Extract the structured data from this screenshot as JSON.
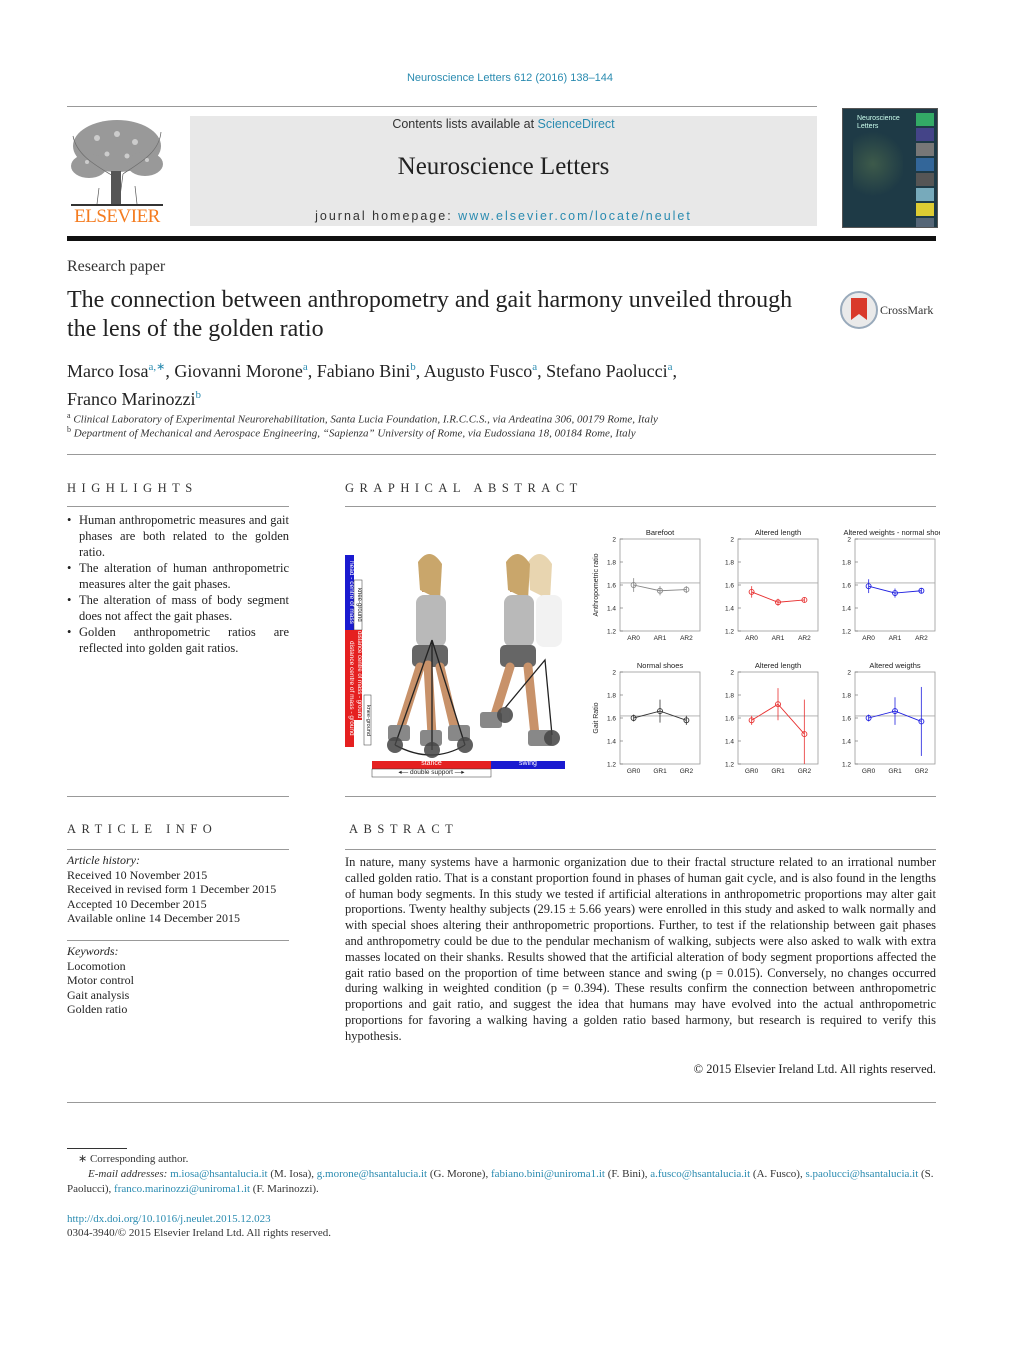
{
  "header": {
    "journal_ref": "Neuroscience Letters 612 (2016) 138–144",
    "contents_prefix": "Contents lists available at ",
    "contents_link": "ScienceDirect",
    "journal_title": "Neuroscience Letters",
    "homepage_prefix": "journal homepage: ",
    "homepage_link": "www.elsevier.com/locate/neulet",
    "publisher": "ELSEVIER",
    "cover_title": "Neuroscience Letters",
    "crossmark": "CrossMark"
  },
  "article": {
    "kind": "Research paper",
    "title": "The connection between anthropometry and gait harmony unveiled through the lens of the golden ratio",
    "authors": [
      {
        "name": "Marco Iosa",
        "sup": "a,∗",
        "sep": ", "
      },
      {
        "name": "Giovanni Morone",
        "sup": "a",
        "sep": ", "
      },
      {
        "name": "Fabiano Bini",
        "sup": "b",
        "sep": ", "
      },
      {
        "name": "Augusto Fusco",
        "sup": "a",
        "sep": ", "
      },
      {
        "name": "Stefano Paolucci",
        "sup": "a",
        "sep": ","
      },
      {
        "name": "Franco Marinozzi",
        "sup": "b",
        "sep": ""
      }
    ],
    "affiliations": [
      {
        "mark": "a",
        "text": "Clinical Laboratory of Experimental Neurorehabilitation, Santa Lucia Foundation, I.R.C.C.S., via Ardeatina 306, 00179 Rome, Italy"
      },
      {
        "mark": "b",
        "text": "Department of Mechanical and Aerospace Engineering, “Sapienza” University of Rome, via Eudossiana 18, 00184 Rome, Italy"
      }
    ]
  },
  "highlights": {
    "heading": "HIGHLIGHTS",
    "items": [
      "Human anthropometric measures and gait phases are both related to the golden ratio.",
      "The alteration of human anthropometric measures alter the gait phases.",
      "The alteration of mass of body segment does not affect the gait phases.",
      "Golden anthropometric ratios are reflected into golden gait ratios."
    ]
  },
  "graphical_abstract": {
    "heading": "GRAPHICAL ABSTRACT",
    "figure_labels": {
      "head_com": "head - centre of mass",
      "com_ground": "distance centre of mass - ground",
      "knee_ground_top": "knee-ground",
      "com_ground_2": "distance centre of mass - ground",
      "knee_ground_bottom": "knee-ground",
      "stance": "stance",
      "swing": "swing",
      "double_support": "double support"
    }
  },
  "chart_data": [
    {
      "type": "line",
      "title": "Barefoot",
      "ylabel": "Anthropometric ratio",
      "categories": [
        "AR0",
        "AR1",
        "AR2"
      ],
      "values": [
        1.6,
        1.55,
        1.56
      ],
      "errors": [
        0.06,
        0.04,
        0.03
      ],
      "ylim": [
        1.2,
        2
      ],
      "yticks": [
        1.2,
        1.4,
        1.6,
        1.8,
        2
      ],
      "reference_line": 1.618,
      "color": "#888888"
    },
    {
      "type": "line",
      "title": "Altered length",
      "ylabel": "",
      "categories": [
        "AR0",
        "AR1",
        "AR2"
      ],
      "values": [
        1.54,
        1.45,
        1.47
      ],
      "errors": [
        0.05,
        0.03,
        0.02
      ],
      "ylim": [
        1.2,
        2
      ],
      "yticks": [
        1.2,
        1.4,
        1.6,
        1.8,
        2
      ],
      "reference_line": 1.618,
      "color": "#e83030"
    },
    {
      "type": "line",
      "title": "Altered weights - normal shoes",
      "ylabel": "",
      "categories": [
        "AR0",
        "AR1",
        "AR2"
      ],
      "values": [
        1.59,
        1.53,
        1.55
      ],
      "errors": [
        0.06,
        0.04,
        0.02
      ],
      "ylim": [
        1.2,
        2
      ],
      "yticks": [
        1.2,
        1.4,
        1.6,
        1.8,
        2
      ],
      "reference_line": 1.618,
      "color": "#2020e0"
    },
    {
      "type": "line",
      "title": "Normal shoes",
      "ylabel": "Gait Ratio",
      "categories": [
        "GR0",
        "GR1",
        "GR2"
      ],
      "values": [
        1.6,
        1.66,
        1.58
      ],
      "errors": [
        0.03,
        0.1,
        0.04
      ],
      "ylim": [
        1.2,
        2
      ],
      "yticks": [
        1.2,
        1.4,
        1.6,
        1.8,
        2
      ],
      "reference_line": 1.618,
      "color": "#333333"
    },
    {
      "type": "line",
      "title": "Altered length",
      "ylabel": "",
      "categories": [
        "GR0",
        "GR1",
        "GR2"
      ],
      "values": [
        1.58,
        1.72,
        1.46
      ],
      "errors": [
        0.04,
        0.14,
        0.3
      ],
      "ylim": [
        1.2,
        2
      ],
      "yticks": [
        1.2,
        1.4,
        1.6,
        1.8,
        2
      ],
      "reference_line": 1.618,
      "color": "#e83030"
    },
    {
      "type": "line",
      "title": "Altered weigths",
      "ylabel": "",
      "categories": [
        "GR0",
        "GR1",
        "GR2"
      ],
      "values": [
        1.6,
        1.66,
        1.57
      ],
      "errors": [
        0.03,
        0.12,
        0.3
      ],
      "ylim": [
        1.2,
        2
      ],
      "yticks": [
        1.2,
        1.4,
        1.6,
        1.8,
        2
      ],
      "reference_line": 1.618,
      "color": "#2020e0"
    }
  ],
  "article_info": {
    "heading": "ARTICLE INFO",
    "history_label": "Article history:",
    "history": [
      "Received 10 November 2015",
      "Received in revised form 1 December 2015",
      "Accepted 10 December 2015",
      "Available online 14 December 2015"
    ],
    "keywords_label": "Keywords:",
    "keywords": [
      "Locomotion",
      "Motor control",
      "Gait analysis",
      "Golden ratio"
    ]
  },
  "abstract": {
    "heading": "ABSTRACT",
    "text": "In nature, many systems have a harmonic organization due to their fractal structure related to an irrational number called golden ratio. That is a constant proportion found in phases of human gait cycle, and is also found in the lengths of human body segments. In this study we tested if artificial alterations in anthropometric proportions may alter gait proportions. Twenty healthy subjects (29.15 ± 5.66 years) were enrolled in this study and asked to walk normally and with special shoes altering their anthropometric proportions. Further, to test if the relationship between gait phases and anthropometry could be due to the pendular mechanism of walking, subjects were also asked to walk with extra masses located on their shanks. Results showed that the artificial alteration of body segment proportions affected the gait ratio based on the proportion of time between stance and swing (p = 0.015). Conversely, no changes occurred during walking in weighted condition (p = 0.394). These results confirm the connection between anthropometric proportions and gait ratio, and suggest the idea that humans may have evolved into the actual anthropometric proportions for favoring a walking having a golden ratio based harmony, but research is required to verify this hypothesis.",
    "copyright": "© 2015 Elsevier Ireland Ltd. All rights reserved."
  },
  "footnotes": {
    "corresponding": "∗ Corresponding author.",
    "email_label": "E-mail addresses:",
    "emails": [
      {
        "email": "m.iosa@hsantalucia.it",
        "name": "(M. Iosa),"
      },
      {
        "email": "g.morone@hsantalucia.it",
        "name": "(G. Morone),"
      },
      {
        "email": "fabiano.bini@uniroma1.it",
        "name": "(F. Bini),"
      },
      {
        "email": "a.fusco@hsantalucia.it",
        "name": "(A. Fusco),"
      },
      {
        "email": "s.paolucci@hsantalucia.it",
        "name": "(S. Paolucci),"
      },
      {
        "email": "franco.marinozzi@uniroma1.it",
        "name": "(F. Marinozzi)."
      }
    ],
    "doi": "http://dx.doi.org/10.1016/j.neulet.2015.12.023",
    "issn": "0304-3940/© 2015 Elsevier Ireland Ltd. All rights reserved."
  }
}
